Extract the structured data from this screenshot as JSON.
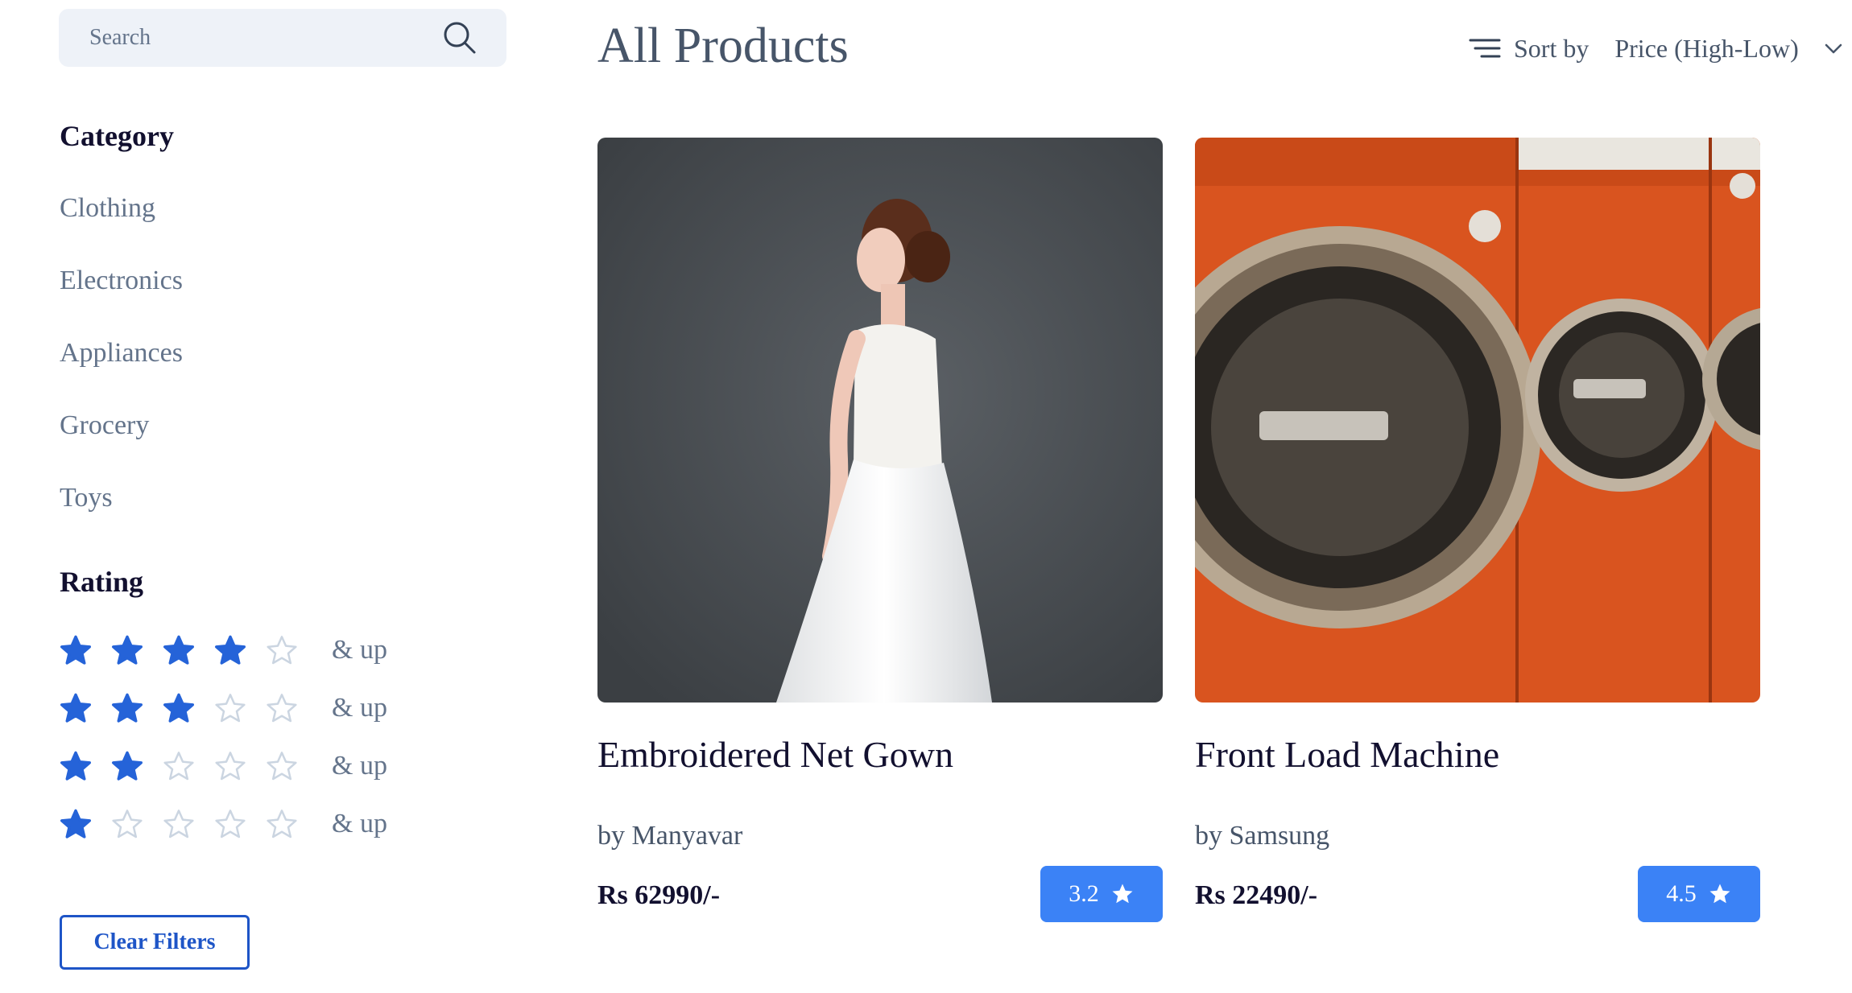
{
  "search": {
    "placeholder": "Search",
    "value": ""
  },
  "sidebar": {
    "category_heading": "Category",
    "categories": [
      "Clothing",
      "Electronics",
      "Appliances",
      "Grocery",
      "Toys"
    ],
    "rating_heading": "Rating",
    "rating_filters": [
      {
        "filled": 4,
        "total": 5,
        "suffix": "& up"
      },
      {
        "filled": 3,
        "total": 5,
        "suffix": "& up"
      },
      {
        "filled": 2,
        "total": 5,
        "suffix": "& up"
      },
      {
        "filled": 1,
        "total": 5,
        "suffix": "& up"
      }
    ],
    "clear_label": "Clear Filters"
  },
  "header": {
    "title": "All Products",
    "sort_label": "Sort by",
    "sort_value": "Price (High-Low)"
  },
  "products": [
    {
      "title": "Embroidered Net Gown",
      "brand": "by Manyavar",
      "price": "Rs 62990/-",
      "rating": "3.2",
      "image": "dress-photo"
    },
    {
      "title": "Front Load Machine",
      "brand": "by Samsung",
      "price": "Rs 22490/-",
      "rating": "4.5",
      "image": "washing-machine-photo"
    }
  ],
  "colors": {
    "accent": "#1e55c7",
    "badge": "#3b82f6",
    "star_filled": "#2563d8",
    "star_empty": "#cbd5e1"
  },
  "icons": {
    "search": "search-icon",
    "sort": "sort-lines-icon",
    "dropdown": "chevron-down-icon",
    "star": "star-icon"
  }
}
